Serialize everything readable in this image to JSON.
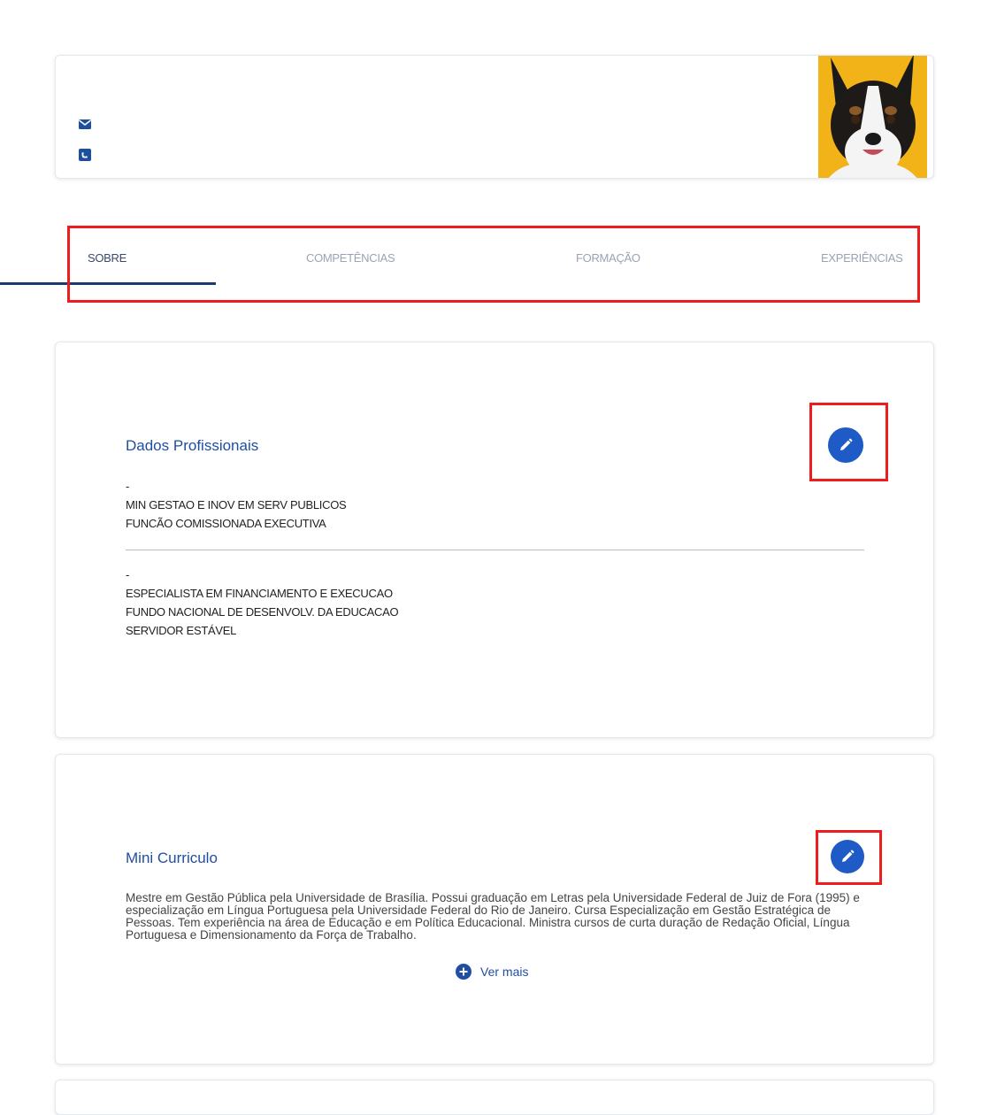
{
  "profile": {
    "icons": [
      "envelope-icon",
      "phone-icon"
    ],
    "photo": "dog-photo"
  },
  "tabs": [
    {
      "label": "SOBRE",
      "active": true
    },
    {
      "label": "COMPETÊNCIAS",
      "active": false
    },
    {
      "label": "FORMAÇÃO",
      "active": false
    },
    {
      "label": "EXPERIÊNCIAS",
      "active": false
    }
  ],
  "dados_profissionais": {
    "title": "Dados Profissionais",
    "block1": [
      "-",
      "MIN GESTAO E INOV EM SERV PUBLICOS",
      "FUNCÃO COMISSIONADA EXECUTIVA"
    ],
    "block2": [
      "-",
      "ESPECIALISTA EM FINANCIAMENTO E EXECUCAO",
      "FUNDO NACIONAL DE DESENVOLV. DA EDUCACAO",
      "SERVIDOR ESTÁVEL"
    ],
    "edit_icon": "pencil-icon"
  },
  "mini_curriculo": {
    "title": "Mini Curriculo",
    "text": "Mestre em Gestão Pública pela Universidade de Brasília. Possui graduação em Letras pela Universidade Federal de Juiz de Fora (1995) e especialização em Língua Portuguesa pela Universidade Federal do Rio de Janeiro. Cursa Especialização em Gestão Estratégica de Pessoas. Tem experiência na área de Educação e em Política Educacional. Ministra cursos de curta duração de Redação Oficial, Língua Portuguesa e Dimensionamento da Força de Trabalho.",
    "ver_mais": "Ver mais",
    "edit_icon": "pencil-icon"
  },
  "colors": {
    "accent": "#1e5bc6",
    "title_blue": "#1f4ea3",
    "highlight_red": "#ee1c1c",
    "tab_underline": "#1a3b6e",
    "photo_bg": "#f2b318"
  }
}
